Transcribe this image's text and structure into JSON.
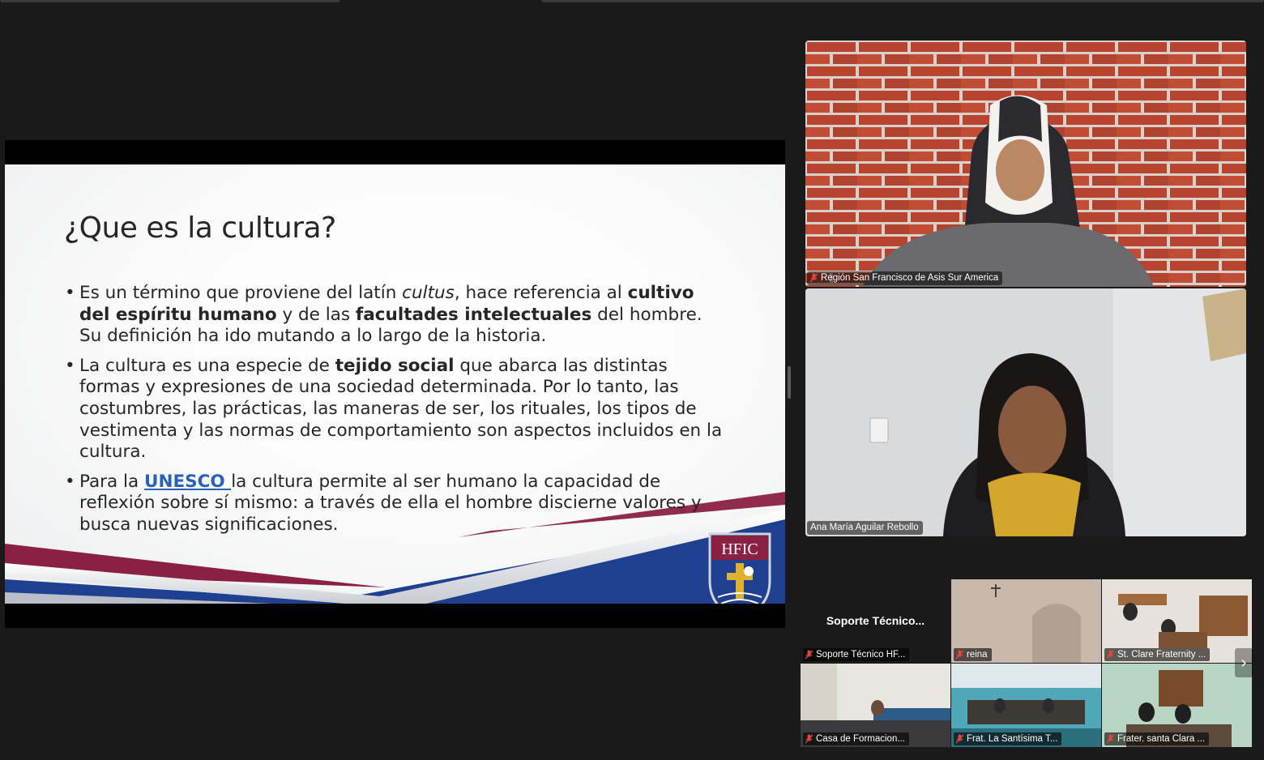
{
  "slide": {
    "title": "¿Que es la cultura?",
    "bullet1": {
      "t1": "Es un término que proviene del latín ",
      "t2": "cultus",
      "t3": ", hace referencia al ",
      "t4": "cultivo del espíritu humano",
      "t5": " y de las ",
      "t6": "facultades intelectuales",
      "t7": " del hombre. Su definición ha ido mutando a lo largo de la historia."
    },
    "bullet2": {
      "t1": "La cultura es una especie de ",
      "t2": "tejido social",
      "t3": " que abarca las distintas formas y expresiones de una sociedad determinada. Por lo tanto, las costumbres, las prácticas, las maneras de ser, los rituales, los tipos de vestimenta y las normas de comportamiento son aspectos incluidos en la cultura."
    },
    "bullet3": {
      "t1": "Para la ",
      "link": "UNESCO ",
      "t2": " la cultura permite al ser humano la capacidad de reflexión sobre sí mismo: a través de ella el hombre discierne valores y busca nuevas significaciones."
    },
    "logo_text": "HFIC",
    "colors": {
      "maroon": "#8a2044",
      "navy": "#1f3f8f",
      "link": "#2b62b8"
    }
  },
  "participants": {
    "main": [
      {
        "name": "Región San Francisco de Asis Sur America",
        "mic": "muted"
      },
      {
        "name": "Ana María Aguilar Rebollo",
        "speaking": true
      }
    ],
    "gallery": [
      {
        "name": "Soporte Técnico HF...",
        "center_text": "Soporte  Técnico...",
        "mic": "muted"
      },
      {
        "name": "reina",
        "mic": "muted"
      },
      {
        "name": "St. Clare Fraternity ...",
        "mic": "muted"
      },
      {
        "name": "Casa de Formacion...",
        "mic": "muted"
      },
      {
        "name": "Frat. La Santísima T...",
        "mic": "muted"
      },
      {
        "name": "Frater. santa Clara ...",
        "mic": "muted"
      }
    ]
  },
  "controls": {
    "next_icon": "chevron-right-icon",
    "next_glyph": "›"
  },
  "theme": {
    "speaking_border": "#2ed35f",
    "background": "#1a1a1a"
  }
}
